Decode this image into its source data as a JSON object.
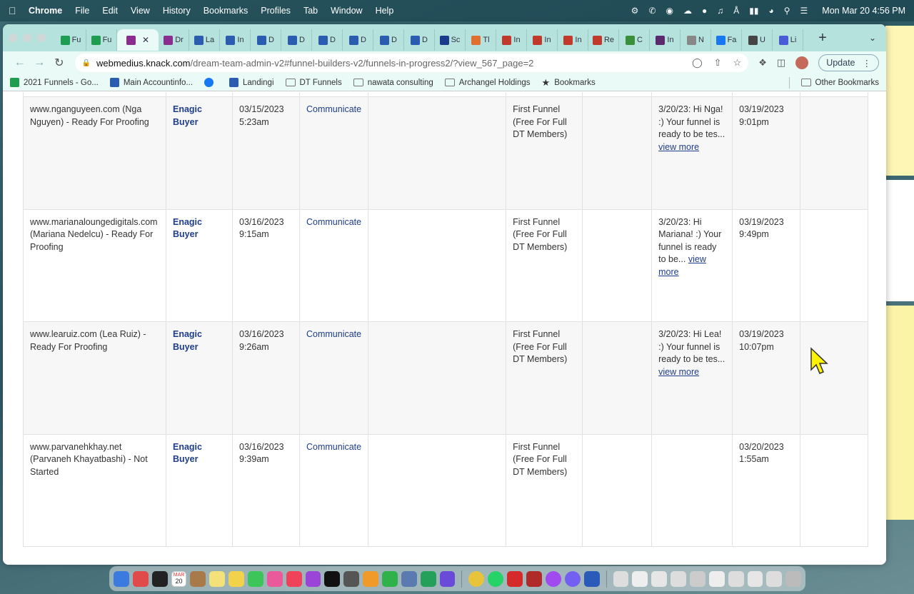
{
  "menubar": {
    "app": "Chrome",
    "items": [
      "File",
      "Edit",
      "View",
      "History",
      "Bookmarks",
      "Profiles",
      "Tab",
      "Window",
      "Help"
    ],
    "clock": "Mon Mar 20  4:56 PM"
  },
  "tabs": [
    {
      "label": "Fu",
      "color": "#1e9d50"
    },
    {
      "label": "Fu",
      "color": "#1e9d50"
    },
    {
      "label": "",
      "color": "#8a2d8f",
      "active": true
    },
    {
      "label": "Dr",
      "color": "#8a2d8f"
    },
    {
      "label": "La",
      "color": "#2a5db0"
    },
    {
      "label": "In",
      "color": "#2a5db0"
    },
    {
      "label": "D",
      "color": "#2a5db0"
    },
    {
      "label": "D",
      "color": "#2a5db0"
    },
    {
      "label": "D",
      "color": "#2a5db0"
    },
    {
      "label": "D",
      "color": "#2a5db0"
    },
    {
      "label": "D",
      "color": "#2a5db0"
    },
    {
      "label": "D",
      "color": "#2a5db0"
    },
    {
      "label": "Sc",
      "color": "#1a3b8c"
    },
    {
      "label": "Tl",
      "color": "#e07030"
    },
    {
      "label": "In",
      "color": "#c0392b"
    },
    {
      "label": "In",
      "color": "#c0392b"
    },
    {
      "label": "In",
      "color": "#c0392b"
    },
    {
      "label": "Re",
      "color": "#c0392b"
    },
    {
      "label": "C",
      "color": "#3a8f3a"
    },
    {
      "label": "In",
      "color": "#5b2a6e"
    },
    {
      "label": "N",
      "color": "#888888"
    },
    {
      "label": "Fa",
      "color": "#1877f2"
    },
    {
      "label": "U",
      "color": "#444444"
    },
    {
      "label": "Li",
      "color": "#4a5bd8"
    }
  ],
  "address_bar": {
    "host": "webmedius.knack.com",
    "path": "/dream-team-admin-v2#funnel-builders-v2/funnels-in-progress2/?view_567_page=2"
  },
  "update_label": "Update",
  "bookmarks": [
    {
      "label": "2021 Funnels - Go...",
      "type": "sheets"
    },
    {
      "label": "Main Accountinfo...",
      "type": "vimeo"
    },
    {
      "label": "",
      "type": "facebook"
    },
    {
      "label": "Landingi",
      "type": "vimeo"
    },
    {
      "label": "DT Funnels",
      "type": "folder"
    },
    {
      "label": "nawata consulting",
      "type": "folder"
    },
    {
      "label": "Archangel Holdings",
      "type": "folder"
    },
    {
      "label": "Bookmarks",
      "type": "star"
    }
  ],
  "other_bookmarks": "Other Bookmarks",
  "rows": [
    {
      "site": "www.nganguyeen.com (Nga Nguyen) - Ready For Proofing",
      "type": "Enagic Buyer",
      "date": "03/15/2023 5:23am",
      "action": "Communicate",
      "funnel": "First Funnel (Free For Full DT Members)",
      "note": "3/20/23: Hi Nga! :) Your funnel is ready to be tes...",
      "view_more": "view more",
      "updated": "03/19/2023 9:01pm"
    },
    {
      "site": "www.marianaloungedigitals.com (Mariana Nedelcu) - Ready For Proofing",
      "type": "Enagic Buyer",
      "date": "03/16/2023 9:15am",
      "action": "Communicate",
      "funnel": "First Funnel (Free For Full DT Members)",
      "note": "3/20/23: Hi Mariana! :) Your funnel is ready to be...",
      "view_more": "view more",
      "updated": "03/19/2023 9:49pm"
    },
    {
      "site": "www.learuiz.com (Lea Ruiz) - Ready For Proofing",
      "type": "Enagic Buyer",
      "date": "03/16/2023 9:26am",
      "action": "Communicate",
      "funnel": "First Funnel (Free For Full DT Members)",
      "note": "3/20/23: Hi Lea! :) Your funnel is ready to be tes...",
      "view_more": "view more",
      "updated": "03/19/2023 10:07pm"
    },
    {
      "site": "www.parvanehkhay.net (Parvaneh Khayatbashi) - Not Started",
      "type": "Enagic Buyer",
      "date": "03/16/2023 9:39am",
      "action": "Communicate",
      "funnel": "First Funnel (Free For Full DT Members)",
      "note": "",
      "view_more": "",
      "updated": "03/20/2023 1:55am"
    }
  ],
  "dock": {
    "calendar_month": "MAR",
    "calendar_day": "20"
  }
}
